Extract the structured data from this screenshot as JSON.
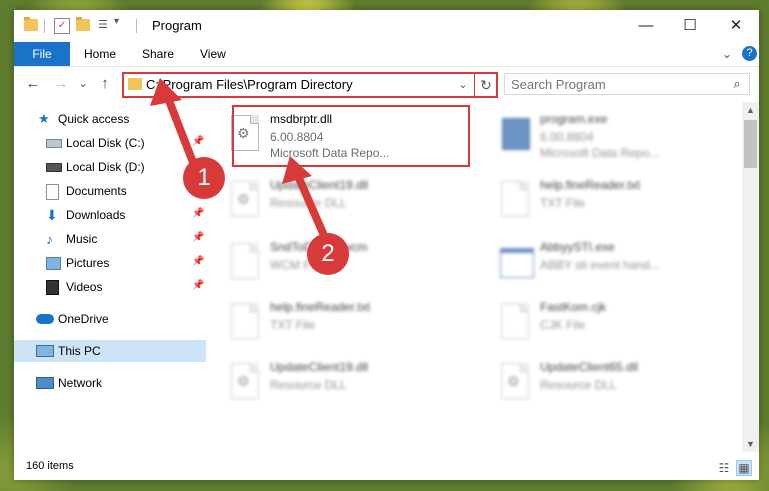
{
  "window": {
    "title": "Program",
    "controls": {
      "minimize": "—",
      "maximize": "☐",
      "close": "✕"
    }
  },
  "ribbon": {
    "tabs": [
      "File",
      "Home",
      "Share",
      "View"
    ],
    "expand": "⌄",
    "help": "?"
  },
  "nav": {
    "back": "←",
    "forward": "→",
    "recent": "⌄",
    "up": "↑",
    "address": "C:\\Program Files\\Program Directory",
    "address_dropdown": "⌄",
    "refresh": "↻",
    "search_placeholder": "Search Program",
    "search_icon": "search-icon"
  },
  "sidebar": {
    "items": [
      {
        "label": "Quick access",
        "icon": "star-icon",
        "pinned": false
      },
      {
        "label": "Local Disk (C:)",
        "icon": "drive-icon",
        "pinned": true
      },
      {
        "label": "Local Disk (D:)",
        "icon": "drive-icon",
        "pinned": false
      },
      {
        "label": "Documents",
        "icon": "documents-icon",
        "pinned": true
      },
      {
        "label": "Downloads",
        "icon": "download-icon",
        "pinned": true
      },
      {
        "label": "Music",
        "icon": "music-icon",
        "pinned": true
      },
      {
        "label": "Pictures",
        "icon": "pictures-icon",
        "pinned": true
      },
      {
        "label": "Videos",
        "icon": "videos-icon",
        "pinned": true
      },
      {
        "label": "OneDrive",
        "icon": "cloud-icon",
        "pinned": false
      },
      {
        "label": "This PC",
        "icon": "computer-icon",
        "pinned": false,
        "selected": true
      },
      {
        "label": "Network",
        "icon": "network-icon",
        "pinned": false
      }
    ],
    "pin_glyph": "📌"
  },
  "files": [
    {
      "name": "msdbrptr.dll",
      "line1": "6.00.8804",
      "line2": "Microsoft Data Repo...",
      "icon": "dll-gear-icon",
      "highlighted": true
    },
    {
      "name": "program.exe",
      "line1": "6.00.8804",
      "line2": "Microsoft Data Repo...",
      "icon": "exe-icon",
      "blurred": true
    },
    {
      "name": "UpdateClient19.dll",
      "line1": "Resource DLL",
      "line2": "",
      "icon": "dll-gear-icon",
      "blurred": true
    },
    {
      "name": "help.fineReader.txt",
      "line1": "TXT File",
      "line2": "",
      "icon": "text-file-icon",
      "blurred": true
    },
    {
      "name": "SndToDn302.wcm",
      "line1": "WCM File",
      "line2": "",
      "icon": "text-file-icon",
      "blurred": true
    },
    {
      "name": "AbbyySTI.exe",
      "line1": "ABBY sti event hand...",
      "line2": "",
      "icon": "exe-window-icon",
      "blurred": true
    },
    {
      "name": "help.fineReader.txt",
      "line1": "TXT File",
      "line2": "",
      "icon": "text-file-icon",
      "blurred": true
    },
    {
      "name": "FastKom.cjk",
      "line1": "CJK File",
      "line2": "",
      "icon": "text-file-icon",
      "blurred": true
    },
    {
      "name": "UpdateClient19.dll",
      "line1": "Resource DLL",
      "line2": "",
      "icon": "dll-gear-icon",
      "blurred": true
    },
    {
      "name": "UpdateClient65.dll",
      "line1": "Resource DLL",
      "line2": "",
      "icon": "dll-gear-icon",
      "blurred": true
    }
  ],
  "status": {
    "item_count": "160 items"
  },
  "annotations": {
    "step1": "1",
    "step2": "2"
  },
  "colors": {
    "accent": "#1a73c9",
    "highlight": "#d83a3a",
    "selection": "#cce4f7"
  }
}
